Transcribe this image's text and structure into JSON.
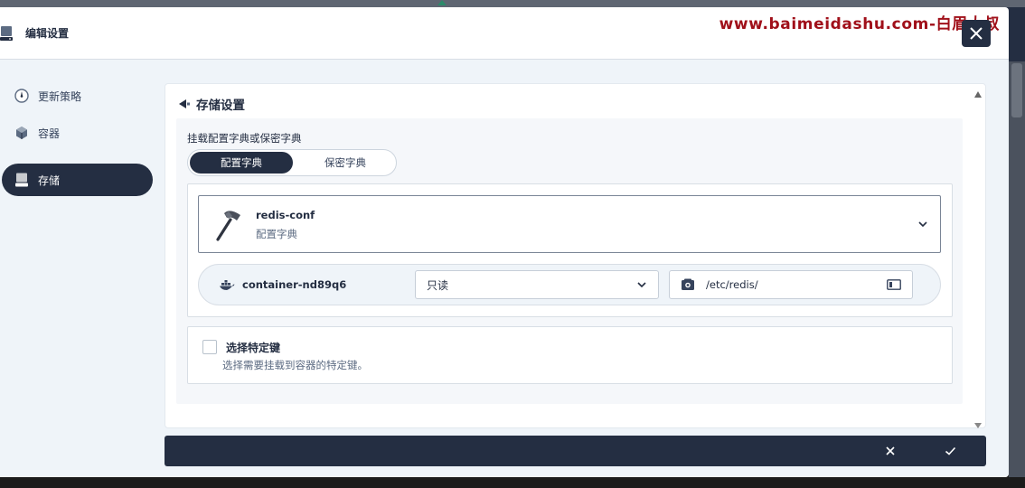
{
  "header": {
    "title": "编辑设置",
    "watermark": "www.baimeidashu.com-白眉大叔"
  },
  "sidebar": {
    "items": [
      {
        "label": "更新策略",
        "icon": "gauge-icon",
        "active": false
      },
      {
        "label": "容器",
        "icon": "cube-icon",
        "active": false
      },
      {
        "label": "存储",
        "icon": "disk-icon",
        "active": true
      }
    ]
  },
  "storage": {
    "section_title": "存储设置",
    "mount_label": "挂载配置字典或保密字典",
    "tabs": [
      {
        "label": "配置字典",
        "selected": true
      },
      {
        "label": "保密字典",
        "selected": false
      }
    ],
    "selected_item": {
      "name": "redis-conf",
      "type": "配置字典"
    },
    "mount": {
      "container": "container-nd89q6",
      "mode": "只读",
      "path": "/etc/redis/"
    },
    "specific_keys": {
      "title": "选择特定键",
      "description": "选择需要挂载到容器的特定键。",
      "checked": false
    }
  },
  "colors": {
    "primary": "#242e42",
    "background": "#eff4f9",
    "watermark": "#a0101a"
  }
}
